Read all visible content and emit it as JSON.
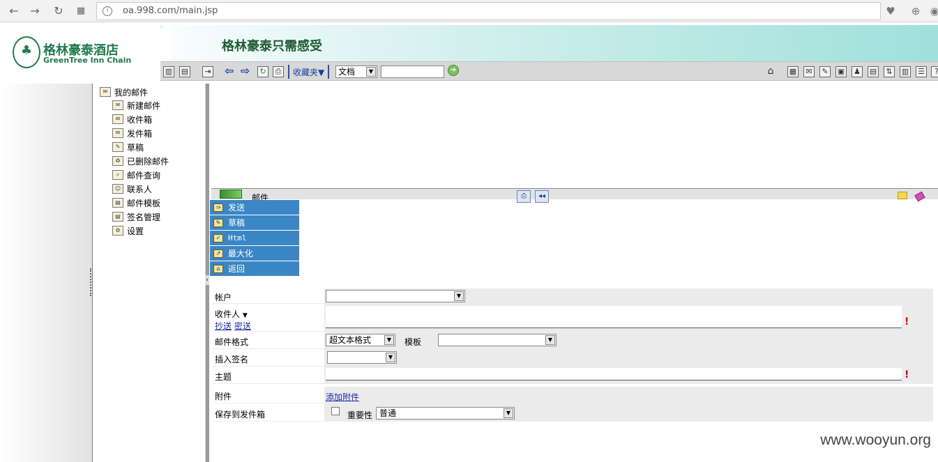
{
  "browser": {
    "url": "oa.998.com/main.jsp"
  },
  "header": {
    "logo_cn": "格林豪泰酒店",
    "logo_en": "GreenTree Inn Chain",
    "slogan": "格林豪泰只需感受",
    "favorites_label": "收藏夹▼",
    "search_scope": "文档",
    "search_value": ""
  },
  "tree": {
    "root": "我的邮件",
    "items": [
      {
        "label": "新建邮件"
      },
      {
        "label": "收件箱"
      },
      {
        "label": "发件箱"
      },
      {
        "label": "草稿"
      },
      {
        "label": "已删除邮件"
      },
      {
        "label": "邮件查询"
      },
      {
        "label": "联系人"
      },
      {
        "label": "邮件模板"
      },
      {
        "label": "签名管理"
      },
      {
        "label": "设置"
      }
    ]
  },
  "mailbar": {
    "title": "邮件"
  },
  "actions": [
    {
      "label": "发送"
    },
    {
      "label": "草稿"
    },
    {
      "label": "Html"
    },
    {
      "label": "最大化"
    },
    {
      "label": "返回"
    }
  ],
  "form": {
    "account_label": "帐户",
    "account_value": "",
    "recipient_label": "收件人",
    "cc_label": "抄送",
    "bcc_label": "密送",
    "recipient_value": "",
    "format_label": "邮件格式",
    "format_value": "超文本格式",
    "template_label": "模板",
    "template_value": "",
    "signature_label": "插入签名",
    "signature_value": "",
    "subject_label": "主题",
    "subject_value": "",
    "required_mark": "!",
    "attachment_label": "附件",
    "add_attachment": "添加附件",
    "save_label": "保存到发件箱",
    "importance_label": "重要性",
    "importance_value": "普通"
  },
  "watermark": "www.wooyun.org"
}
